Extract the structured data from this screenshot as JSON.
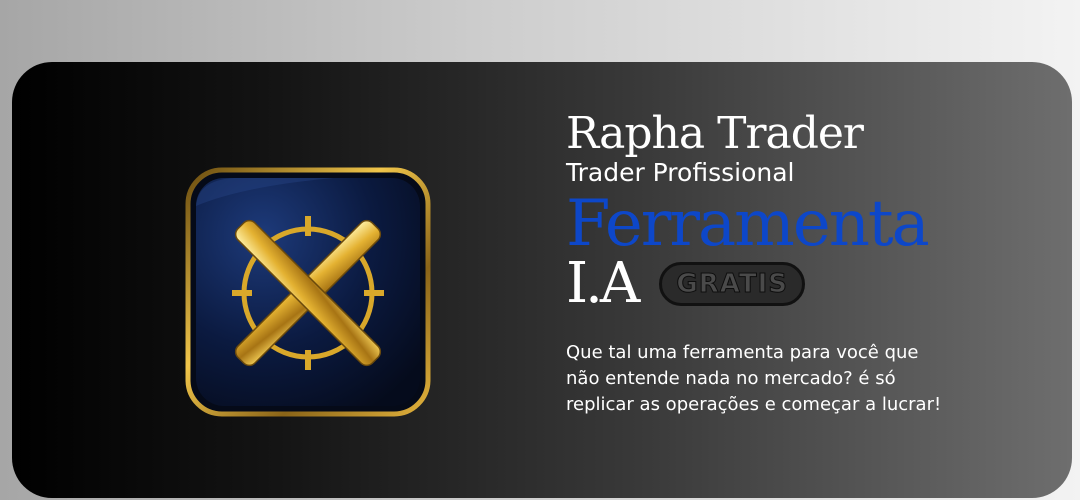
{
  "profile": {
    "name": "Rapha Trader",
    "role": "Trader Profissional"
  },
  "promo": {
    "headline": "Ferramenta",
    "sub_headline": "I.A",
    "badge": "GRATIS",
    "description": "Que tal uma ferramenta para você que não entende nada no mercado? é só replicar as operações e começar a lucrar!"
  },
  "colors": {
    "headline": "#0d47c9",
    "text": "#ffffff",
    "icon_gold": "#d9a82a",
    "icon_navy": "#0b1a40"
  },
  "icons": {
    "app_icon": "crossed-swords-crosshair-icon"
  }
}
